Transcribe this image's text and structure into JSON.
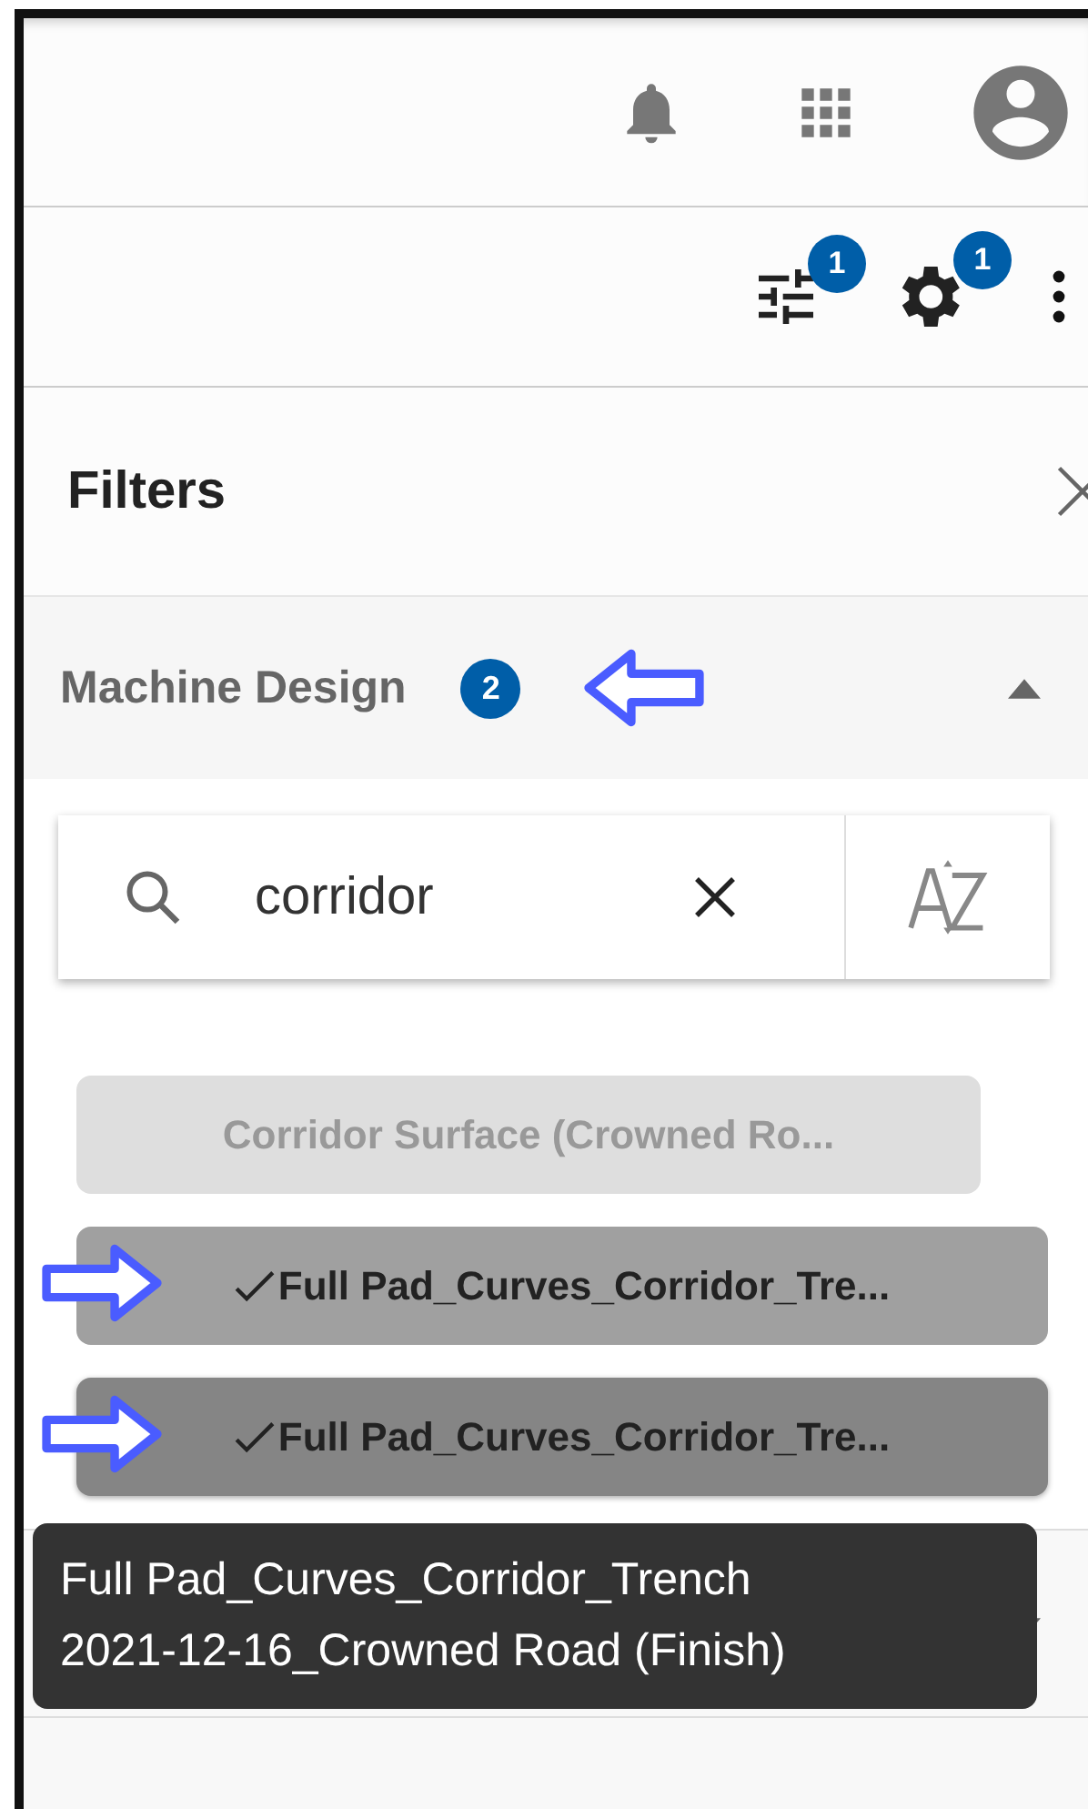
{
  "top_bar": {
    "icons": [
      {
        "kind": "bell"
      },
      {
        "kind": "apps"
      },
      {
        "kind": "account"
      }
    ]
  },
  "toolbar": {
    "filter_badge": "1",
    "settings_badge": "1"
  },
  "panel": {
    "title": "Filters",
    "section": {
      "title": "Machine Design",
      "count": "2",
      "expanded": true,
      "annotation_arrow": true,
      "search": {
        "value": "corridor"
      },
      "items": [
        {
          "label": "Corridor Surface (Crowned Ro...",
          "selected": false,
          "hovered": false,
          "annotation_arrow": false
        },
        {
          "label": "Full Pad_Curves_Corridor_Tre...",
          "selected": true,
          "hovered": false,
          "annotation_arrow": true
        },
        {
          "label": "Full Pad_Curves_Corridor_Tre...",
          "selected": true,
          "hovered": true,
          "annotation_arrow": true
        }
      ]
    },
    "next_section": {
      "expanded": false
    },
    "tooltip": [
      "Full Pad_Curves_Corridor_Trench",
      "2021-12-16_Crowned Road (Finish)"
    ]
  }
}
